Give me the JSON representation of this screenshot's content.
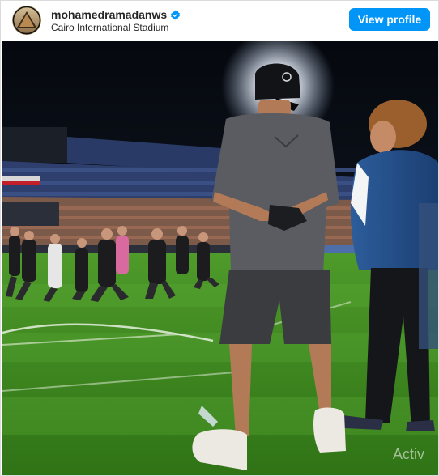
{
  "header": {
    "username": "mohamedramadanws",
    "location": "Cairo International Stadium",
    "view_profile_label": "View profile",
    "verified_icon": "verified-badge-icon"
  },
  "watermark": {
    "text": "Activ"
  },
  "colors": {
    "button": "#0095f6",
    "text": "#262626",
    "pitch": "#3f8a1f",
    "sky": "#0b1019"
  }
}
